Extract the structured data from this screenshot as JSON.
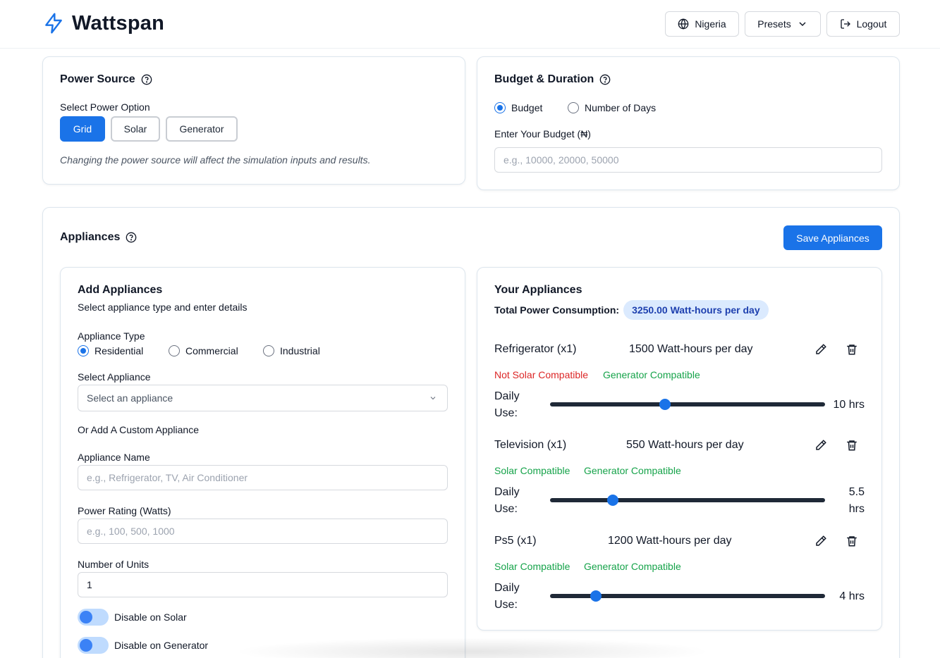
{
  "header": {
    "brand": "Wattspan",
    "country_label": "Nigeria",
    "presets_label": "Presets",
    "logout_label": "Logout"
  },
  "power_source": {
    "title": "Power Source",
    "select_label": "Select Power Option",
    "options": [
      "Grid",
      "Solar",
      "Generator"
    ],
    "selected": "Grid",
    "note": "Changing the power source will affect the simulation inputs and results."
  },
  "budget": {
    "title": "Budget & Duration",
    "modes": [
      "Budget",
      "Number of Days"
    ],
    "selected_mode": "Budget",
    "input_label": "Enter Your Budget (₦)",
    "input_placeholder": "e.g., 10000, 20000, 50000"
  },
  "appliances": {
    "title": "Appliances",
    "save_label": "Save Appliances"
  },
  "add_appliances": {
    "title": "Add Appliances",
    "subtitle": "Select appliance type and enter details",
    "type_label": "Appliance Type",
    "types": [
      "Residential",
      "Commercial",
      "Industrial"
    ],
    "selected_type": "Residential",
    "select_label": "Select Appliance",
    "select_placeholder": "Select an appliance",
    "custom_label": "Or Add A Custom Appliance",
    "name_label": "Appliance Name",
    "name_placeholder": "e.g., Refrigerator, TV, Air Conditioner",
    "power_label": "Power Rating (Watts)",
    "power_placeholder": "e.g., 100, 500, 1000",
    "units_label": "Number of Units",
    "units_value": "1",
    "disable_solar_label": "Disable on Solar",
    "disable_generator_label": "Disable on Generator"
  },
  "your_appliances": {
    "title": "Your Appliances",
    "total_label": "Total Power Consumption:",
    "total_value": "3250.00 Watt-hours per day",
    "daily_use_label": "Daily Use:",
    "items": [
      {
        "name": "Refrigerator (x1)",
        "wh": "1500 Watt-hours per day",
        "solar": "Not Solar Compatible",
        "generator": "Generator Compatible",
        "hours": "10 hrs",
        "hours_num": 10
      },
      {
        "name": "Television (x1)",
        "wh": "550 Watt-hours per day",
        "solar": "Solar Compatible",
        "generator": "Generator Compatible",
        "hours": "5.5 hrs",
        "hours_num": 5.5
      },
      {
        "name": "Ps5 (x1)",
        "wh": "1200 Watt-hours per day",
        "solar": "Solar Compatible",
        "generator": "Generator Compatible",
        "hours": "4 hrs",
        "hours_num": 4
      }
    ],
    "slider_max_hours": 24
  },
  "colors": {
    "primary": "#1a73e8",
    "incompatible": "#dc2626",
    "compatible": "#16a34a",
    "badge_bg": "#dbeafe"
  }
}
